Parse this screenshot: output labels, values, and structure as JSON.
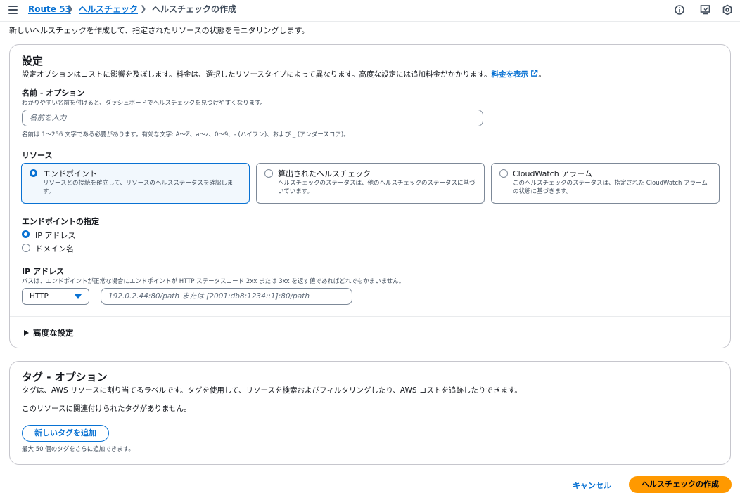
{
  "breadcrumb": {
    "items": [
      {
        "label": "Route 53"
      },
      {
        "label": "ヘルスチェック"
      },
      {
        "label": "ヘルスチェックの作成"
      }
    ]
  },
  "page": {
    "subtitle": "新しいヘルスチェックを作成して、指定されたリソースの状態をモニタリングします。"
  },
  "settings": {
    "title": "設定",
    "description": "設定オプションはコストに影響を及ぼします。料金は、選択したリソースタイプによって異なります。高度な設定には追加料金がかかります。",
    "pricing_link": "料金を表示",
    "pricing_suffix": "。",
    "name": {
      "label": "名前 - オプション",
      "description": "わかりやすい名前を付けると、ダッシュボードでヘルスチェックを見つけやすくなります。",
      "placeholder": "名前を入力",
      "constraint": "名前は 1〜256 文字である必要があります。有効な文字: A〜Z、a〜z、0〜9、- (ハイフン)、および _ (アンダースコア)。"
    },
    "resource": {
      "label": "リソース",
      "options": [
        {
          "title": "エンドポイント",
          "description": "リソースとの接続を確立して、リソースのヘルスステータスを確認します。"
        },
        {
          "title": "算出されたヘルスチェック",
          "description": "ヘルスチェックのステータスは、他のヘルスチェックのステータスに基づいています。"
        },
        {
          "title": "CloudWatch アラーム",
          "description": "このヘルスチェックのステータスは、指定された CloudWatch アラームの状態に基づきます。"
        }
      ],
      "selected_index": 0
    },
    "endpoint_spec": {
      "label": "エンドポイントの指定",
      "options": [
        "IP アドレス",
        "ドメイン名"
      ],
      "selected_index": 0
    },
    "ip": {
      "label": "IP アドレス",
      "description": "パスは、エンドポイントが正常な場合にエンドポイントが HTTP ステータスコード 2xx または 3xx を返す値であればどれでもかまいません。",
      "protocol": "HTTP",
      "placeholder": "192.0.2.44:80/path または [2001:db8:1234::1]:80/path"
    },
    "advanced": {
      "label": "高度な設定"
    }
  },
  "tags": {
    "title": "タグ - オプション",
    "description": "タグは、AWS リソースに割り当てるラベルです。タグを使用して、リソースを検索およびフィルタリングしたり、AWS コストを追跡したりできます。",
    "empty": "このリソースに関連付けられたタグがありません。",
    "add_button": "新しいタグを追加",
    "limit_note": "最大 50 個のタグをさらに追加できます。"
  },
  "footer": {
    "cancel": "キャンセル",
    "create": "ヘルスチェックの作成"
  },
  "colors": {
    "link": "#0972d3",
    "primary_button": "#ff9900",
    "border": "#c6c6cd"
  }
}
